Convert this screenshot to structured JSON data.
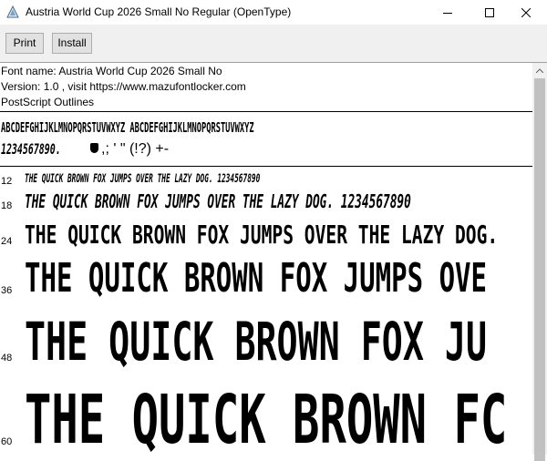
{
  "window": {
    "title": "Austria World Cup 2026 Small No Regular (OpenType)",
    "icons": {
      "app": "font-file-icon",
      "minimize": "minimize-icon",
      "maximize": "maximize-icon",
      "close": "close-icon"
    }
  },
  "toolbar": {
    "print_label": "Print",
    "install_label": "Install"
  },
  "info": {
    "font_name": "Font name: Austria World Cup 2026 Small No",
    "version": "Version: 1.0 , visit https://www.mazufontlocker.com",
    "outlines": "PostScript Outlines"
  },
  "charset": {
    "line1": "ABCDEFGHIJKLMNOPQRSTUVWXYZ ABCDEFGHIJKLMNOPQRSTUVWXYZ",
    "line2_digits": "1234567890.",
    "line2_rest": ",; ' \" (!?) +-"
  },
  "samples": [
    {
      "size": "12",
      "text": "THE QUICK BROWN FOX JUMPS OVER THE LAZY DOG. 1234567890"
    },
    {
      "size": "18",
      "text": "THE QUICK BROWN FOX JUMPS OVER THE LAZY DOG. 1234567890"
    },
    {
      "size": "24",
      "text": "THE QUICK BROWN FOX JUMPS OVER THE LAZY DOG."
    },
    {
      "size": "36",
      "text": "THE QUICK BROWN FOX JUMPS OVE"
    },
    {
      "size": "48",
      "text": "THE QUICK BROWN FOX JU"
    },
    {
      "size": "60",
      "text": "THE QUICK BROWN FC"
    }
  ]
}
